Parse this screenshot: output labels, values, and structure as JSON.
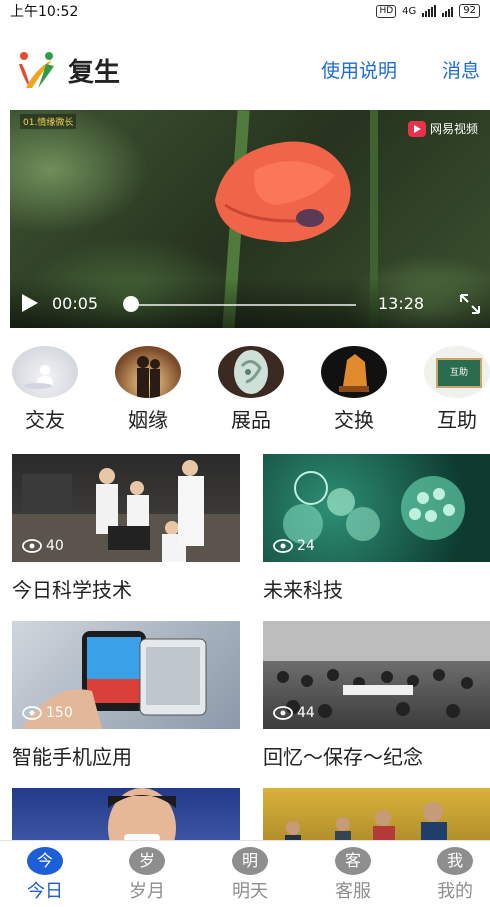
{
  "status_bar": {
    "time": "上午10:52",
    "hd": "HD",
    "network": "4G",
    "battery": "92"
  },
  "header": {
    "app_name": "复生",
    "instructions_link": "使用说明",
    "messages_link": "消息"
  },
  "video": {
    "channel_tag": "01.情缘微长",
    "brand": "网易视频",
    "current_time": "00:05",
    "total_time": "13:28",
    "progress": 0.006
  },
  "categories": [
    {
      "label": "交友"
    },
    {
      "label": "姻缘"
    },
    {
      "label": "展品"
    },
    {
      "label": "交换"
    },
    {
      "label": "互助"
    }
  ],
  "help_board_text": "互助",
  "cards": [
    {
      "title": "今日科学技术",
      "views": "40"
    },
    {
      "title": "未来科技",
      "views": "24"
    },
    {
      "title": "智能手机应用",
      "views": "150"
    },
    {
      "title": "回忆～保存～纪念",
      "views": "44"
    },
    {
      "title": "",
      "views": ""
    },
    {
      "title": "",
      "views": ""
    }
  ],
  "tabs": [
    {
      "char": "今",
      "label": "今日",
      "active": true
    },
    {
      "char": "岁",
      "label": "岁月",
      "active": false
    },
    {
      "char": "明",
      "label": "明天",
      "active": false
    },
    {
      "char": "客",
      "label": "客服",
      "active": false
    },
    {
      "char": "我",
      "label": "我的",
      "active": false
    }
  ],
  "colors": {
    "accent": "#1c5fd6",
    "link": "#1e6bd6",
    "inactive": "#8e8e8e"
  }
}
